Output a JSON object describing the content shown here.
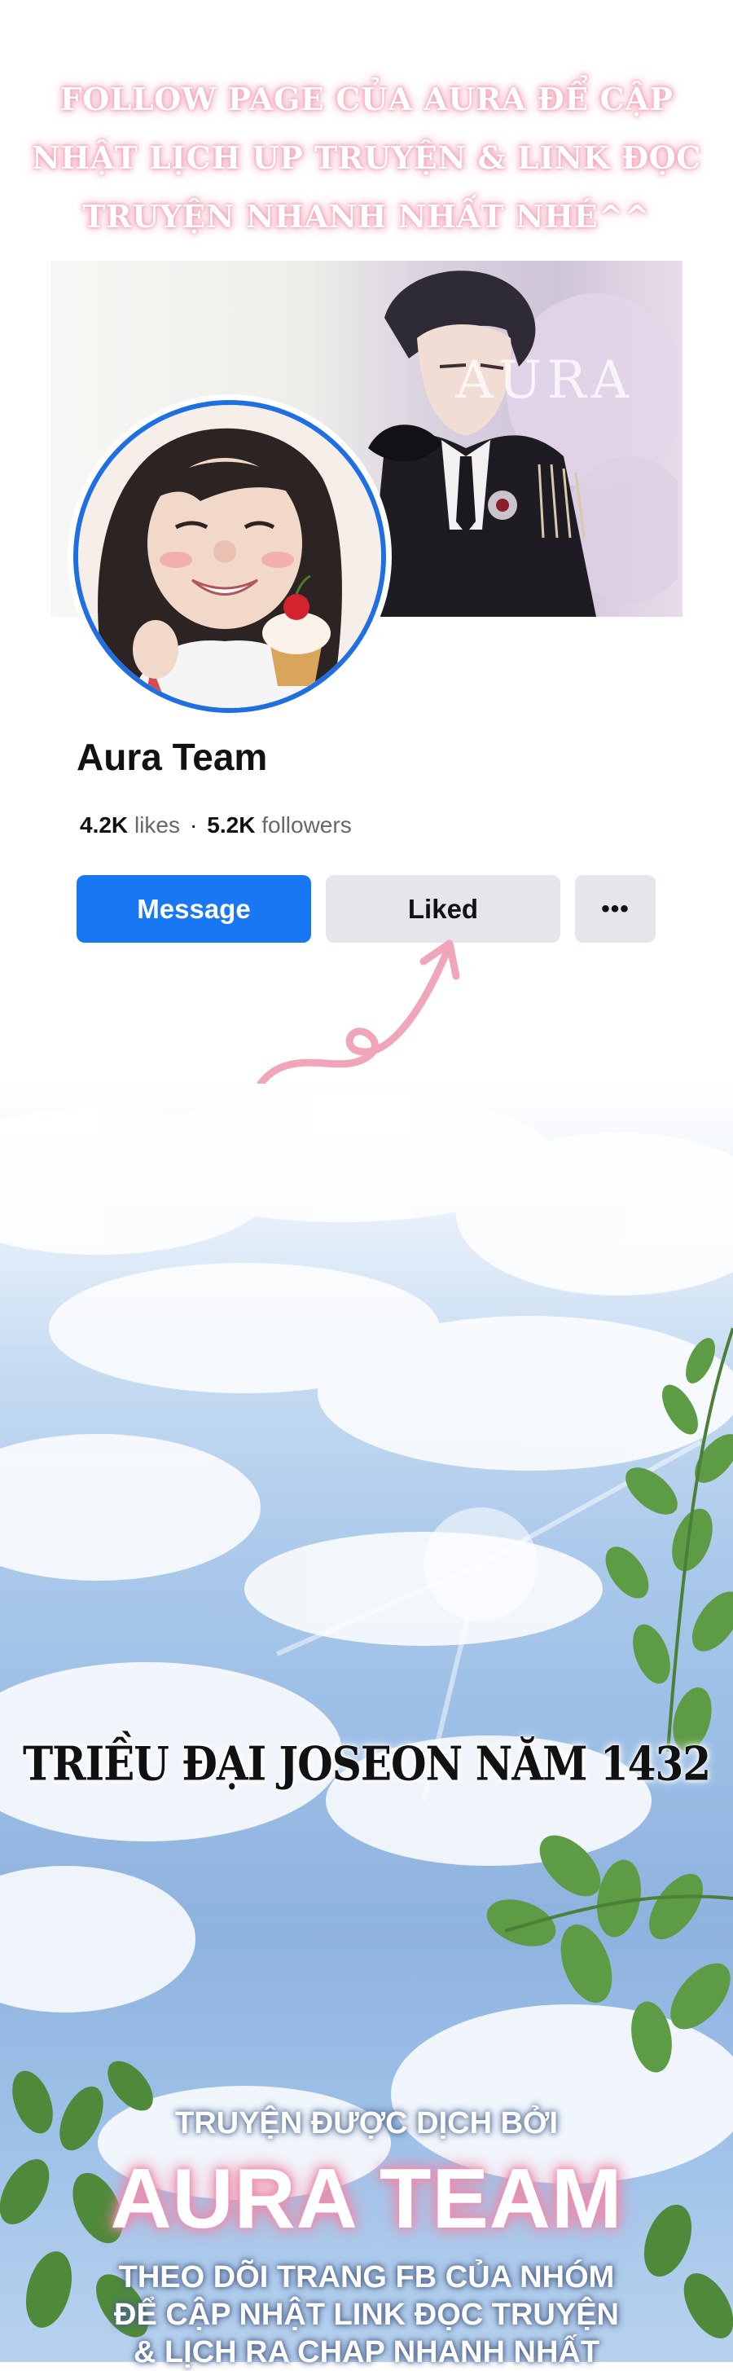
{
  "promo": {
    "lines": [
      "FOLLOW PAGE CỦA AURA ĐỂ CẬP",
      "NHẬT LỊCH UP TRUYỆN & LINK ĐỌC",
      "TRUYỆN NHANH NHẤT NHÉ^^"
    ]
  },
  "profile": {
    "cover_mark": "AURA",
    "name": "Aura Team",
    "likes_count": "4.2K",
    "likes_label": "likes",
    "separator": "·",
    "followers_count": "5.2K",
    "followers_label": "followers",
    "message_label": "Message",
    "liked_label": "Liked",
    "more_label": "•••"
  },
  "story": {
    "era_caption": "TRIỀU ĐẠI JOSEON NĂM 1432"
  },
  "credit": {
    "translated_by": "TRUYỆN ĐƯỢC DỊCH BỞI",
    "team": "AURA TEAM",
    "lines": [
      "THEO DÕI TRANG FB CỦA NHÓM",
      "ĐỂ CẬP NHẬT LINK ĐỌC TRUYỆN",
      "& LỊCH RA CHAP NHANH NHẤT"
    ]
  },
  "colors": {
    "message_blue": "#1877f2",
    "avatar_ring": "#1d6fe3",
    "arrow_pink": "#f0a6b8"
  }
}
